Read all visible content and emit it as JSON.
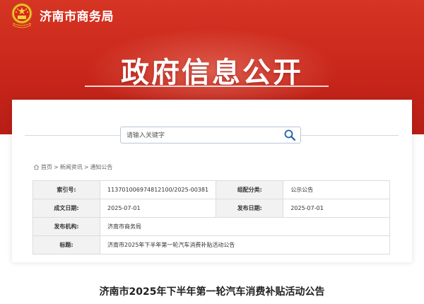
{
  "header": {
    "site_name": "济南市商务局",
    "banner_title": "政府信息公开"
  },
  "search": {
    "placeholder": "请输入关键字"
  },
  "breadcrumb": {
    "home": "首页",
    "sep": ">",
    "news": "新闻资讯",
    "notice": "通知公告"
  },
  "info": {
    "index_no_label": "索引号:",
    "index_no": "11370100697481210​0/2025-00381",
    "category_label": "组配分类:",
    "category": "公示公告",
    "date_label": "成文日期:",
    "date": "2025-07-01",
    "publish_date_label": "发布日期:",
    "publish_date": "2025-07-01",
    "agency_label": "发布机构:",
    "agency": "济南市商务局",
    "title_label": "标题:",
    "title": "济南市2025年下半年第一轮汽车消费补贴活动公告"
  },
  "document": {
    "title": "济南市2025年下半年第一轮汽车消费补贴活动公告"
  },
  "colors": {
    "banner_red": "#c8261a",
    "label_bg": "#f2f2f2",
    "border": "#dcdcdc"
  }
}
